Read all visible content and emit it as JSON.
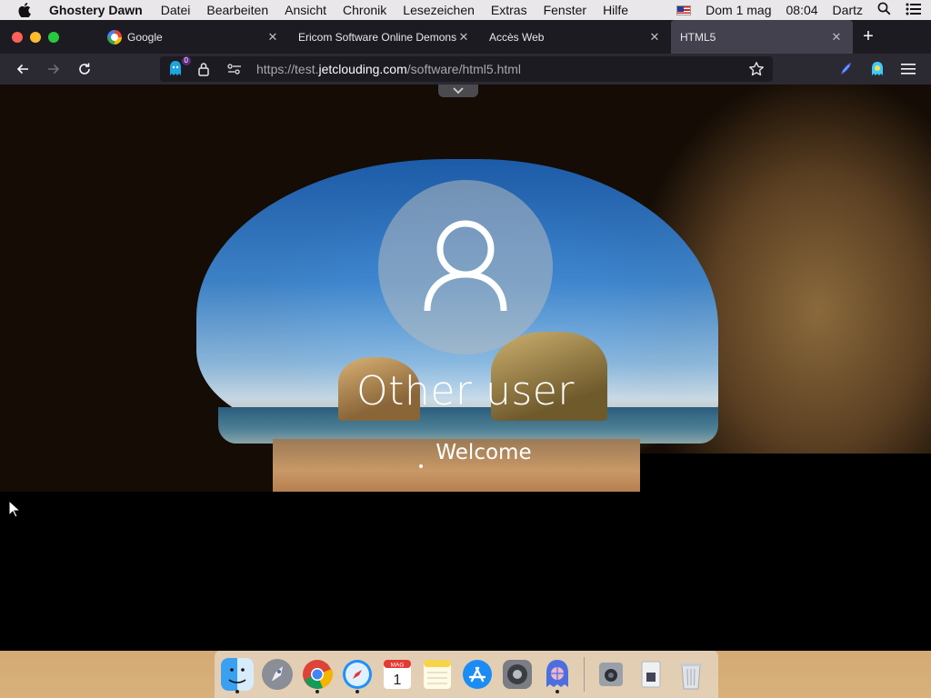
{
  "menubar": {
    "app_name": "Ghostery Dawn",
    "menus": [
      "Datei",
      "Bearbeiten",
      "Ansicht",
      "Chronik",
      "Lesezeichen",
      "Extras",
      "Fenster",
      "Hilfe"
    ],
    "date": "Dom 1 mag",
    "time": "08:04",
    "user": "Dartz"
  },
  "tabs": [
    {
      "label": "Google",
      "active": false
    },
    {
      "label": "Ericom Software Online Demonst",
      "active": false
    },
    {
      "label": "Accès Web",
      "active": false
    },
    {
      "label": "HTML5",
      "active": true
    }
  ],
  "navbar": {
    "url_prefix": "https://test.",
    "url_domain": "jetclouding.com",
    "url_path": "/software/html5.html",
    "ghostery_badge": "0"
  },
  "lockscreen": {
    "username": "Other user",
    "status": "Welcome"
  },
  "dock": {
    "calendar_month": "MAG",
    "calendar_day": "1"
  },
  "colors": {
    "tabbar_bg": "#1c1b22",
    "navbar_bg": "#2b2a33",
    "active_tab": "#42414d"
  }
}
